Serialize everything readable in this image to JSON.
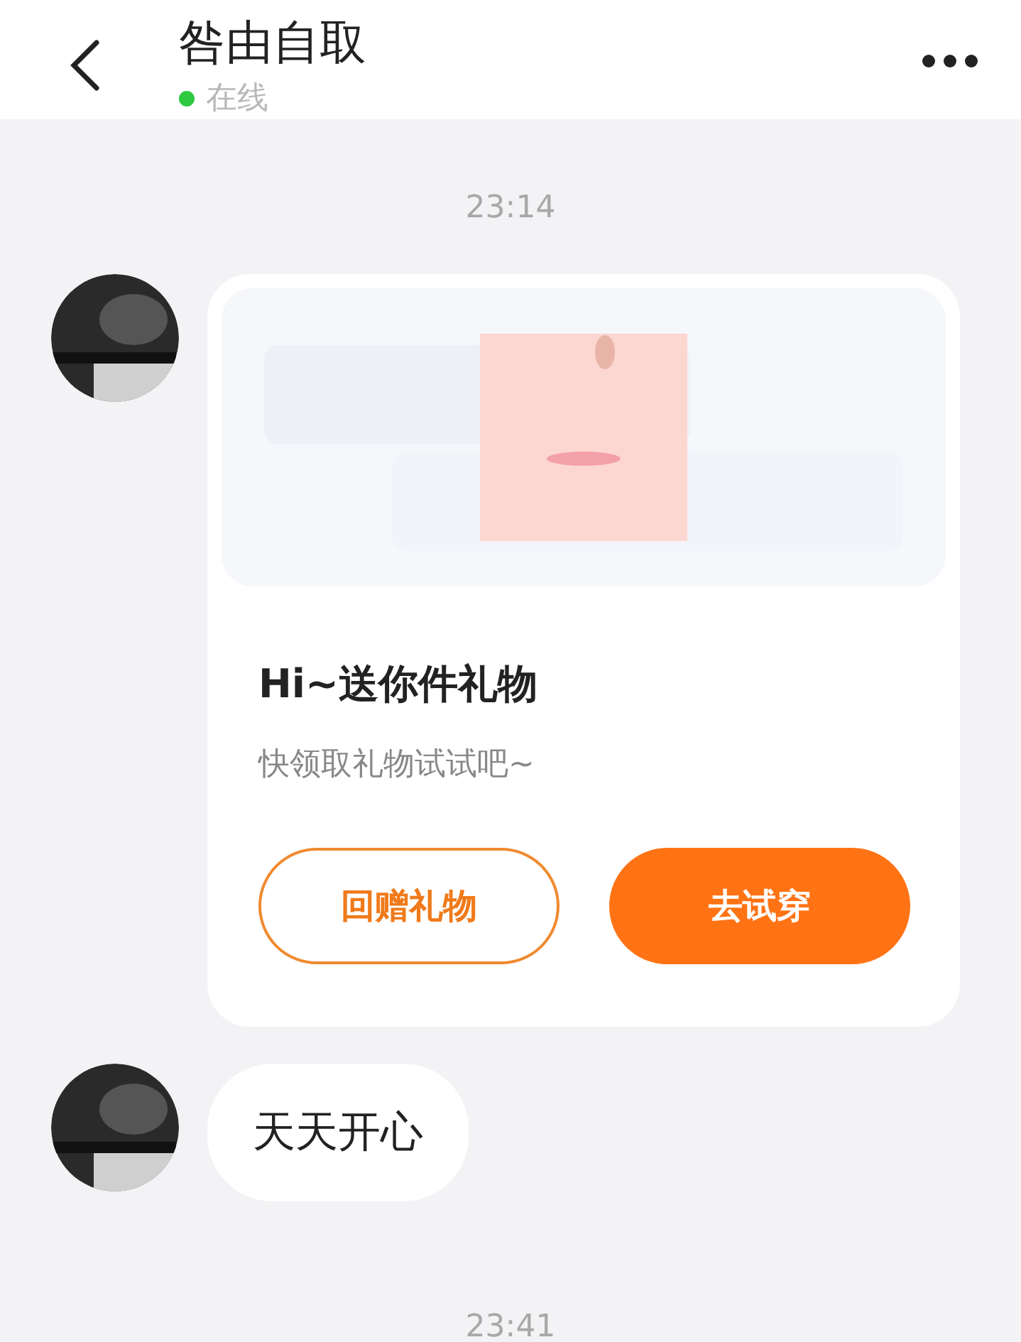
{
  "header": {
    "title": "咎由自取",
    "status": {
      "text": "在线",
      "online": true
    }
  },
  "messages": [
    {
      "kind": "time",
      "text": "23:14"
    },
    {
      "kind": "gift",
      "title": "Hi~送你件礼物",
      "subtitle": "快领取礼物试试吧~",
      "buttons": [
        {
          "label": "回赠礼物",
          "kind": "outline"
        },
        {
          "label": "去试穿",
          "kind": "filled"
        }
      ]
    },
    {
      "kind": "text",
      "text": "天天开心"
    },
    {
      "kind": "time",
      "text": "23:41"
    }
  ]
}
